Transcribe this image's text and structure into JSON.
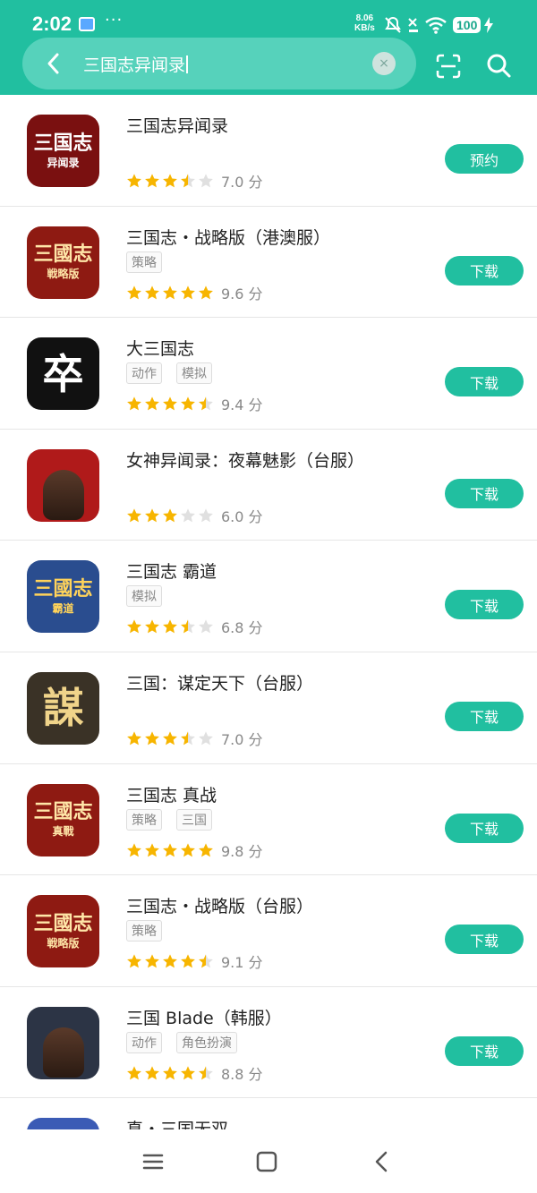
{
  "status_bar": {
    "time": "2:02",
    "dots": "···",
    "net_speed_value": "8.06",
    "net_speed_unit": "KB/s",
    "battery": "100"
  },
  "search": {
    "query": "三国志异闻录",
    "clear_icon": "×"
  },
  "colors": {
    "brand": "#21bfa0",
    "star_filled": "#f7b500",
    "star_empty": "#e0e0e0"
  },
  "results": [
    {
      "title": "三国志异闻录",
      "tags": [],
      "stars": 3.5,
      "score": "7.0 分",
      "button": "预约",
      "icon": {
        "text": "三国志",
        "sub": "异闻录",
        "bg": "#7a1010",
        "fg": "#fff"
      }
    },
    {
      "title": "三国志・战略版（港澳服）",
      "tags": [
        "策略"
      ],
      "stars": 5,
      "score": "9.6 分",
      "button": "下载",
      "icon": {
        "text": "三國志",
        "sub": "戦略版",
        "bg": "#8e1a12",
        "fg": "#ffe6a8"
      }
    },
    {
      "title": "大三国志",
      "tags": [
        "动作",
        "模拟"
      ],
      "stars": 4.5,
      "score": "9.4 分",
      "button": "下载",
      "icon": {
        "text": "卒",
        "sub": "",
        "bg": "#111111",
        "fg": "#ffffff"
      }
    },
    {
      "title": "女神异闻录：夜幕魅影（台服）",
      "tags": [],
      "stars": 3,
      "score": "6.0 分",
      "button": "下载",
      "icon": {
        "text": "",
        "sub": "",
        "bg": "#b01a1a",
        "fg": "#fff"
      }
    },
    {
      "title": "三国志 霸道",
      "tags": [
        "模拟"
      ],
      "stars": 3.5,
      "score": "6.8 分",
      "button": "下载",
      "icon": {
        "text": "三國志",
        "sub": "霸道",
        "bg": "#2a4d8f",
        "fg": "#ffd35a"
      }
    },
    {
      "title": "三国：谋定天下（台服）",
      "tags": [],
      "stars": 3.5,
      "score": "7.0 分",
      "button": "下载",
      "icon": {
        "text": "謀",
        "sub": "",
        "bg": "#3a3226",
        "fg": "#f0d48a"
      }
    },
    {
      "title": "三国志 真战",
      "tags": [
        "策略",
        "三国"
      ],
      "stars": 5,
      "score": "9.8 分",
      "button": "下载",
      "icon": {
        "text": "三國志",
        "sub": "真戰",
        "bg": "#8e1a12",
        "fg": "#ffe6a8"
      }
    },
    {
      "title": "三国志・战略版（台服）",
      "tags": [
        "策略"
      ],
      "stars": 4.5,
      "score": "9.1 分",
      "button": "下载",
      "icon": {
        "text": "三國志",
        "sub": "戦略版",
        "bg": "#8e1a12",
        "fg": "#ffe6a8"
      }
    },
    {
      "title": "三国 Blade（韩服）",
      "tags": [
        "动作",
        "角色扮演"
      ],
      "stars": 4.5,
      "score": "8.8 分",
      "button": "下载",
      "icon": {
        "text": "",
        "sub": "",
        "bg": "#2c3445",
        "fg": "#fff"
      }
    },
    {
      "title": "真・三国无双",
      "tags": [],
      "stars": 0,
      "score": "",
      "button": "",
      "icon": {
        "text": "",
        "sub": "",
        "bg": "#3b5bb5",
        "fg": "#fff"
      }
    }
  ],
  "nav": {
    "menu_icon": "menu-icon",
    "home_icon": "home-icon",
    "back_icon": "back-icon"
  }
}
